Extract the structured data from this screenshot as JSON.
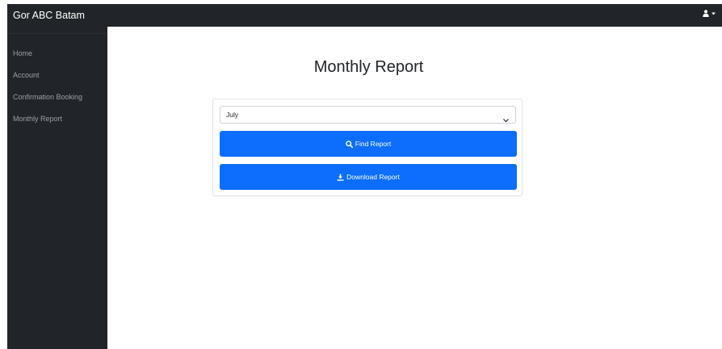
{
  "topbar": {
    "brand": "Gor ABC Batam",
    "user_icon": "user-icon",
    "caret_icon": "caret-down-icon"
  },
  "sidebar": {
    "items": [
      {
        "label": "Home"
      },
      {
        "label": "Account"
      },
      {
        "label": "Confirmation Booking"
      },
      {
        "label": "Monthly Report"
      }
    ]
  },
  "main": {
    "title": "Monthly Report",
    "month_select": {
      "value": "July",
      "icon": "chevron-down-icon"
    },
    "find_button": {
      "label": "Find Report",
      "icon": "search-icon"
    },
    "download_button": {
      "label": "Download Report",
      "icon": "download-icon"
    }
  },
  "colors": {
    "topbar_bg": "#212529",
    "sidebar_bg": "#212529",
    "primary": "#0d6efd"
  }
}
